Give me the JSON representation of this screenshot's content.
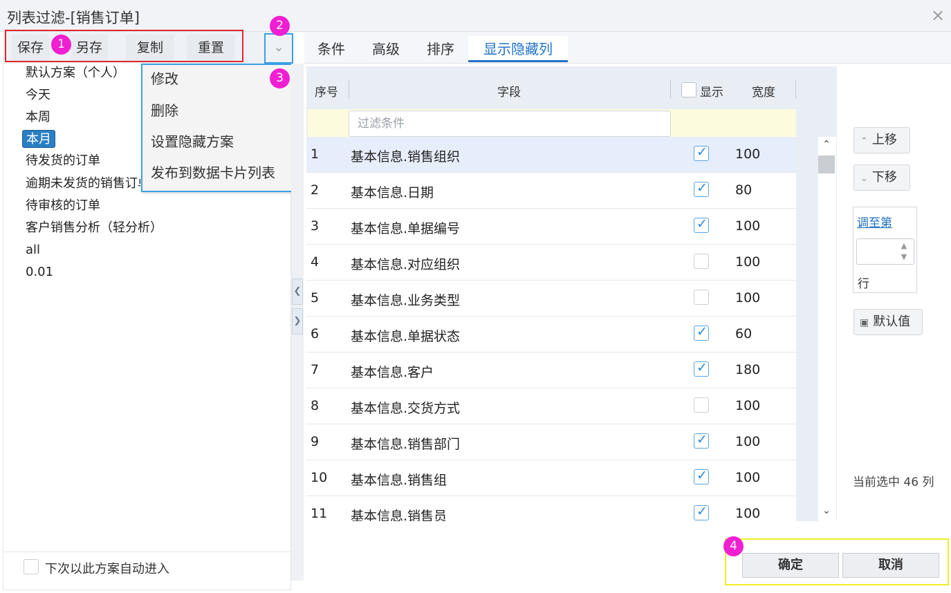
{
  "window": {
    "title": "列表过滤-[销售订单]",
    "close_glyph": "×"
  },
  "toolbar": {
    "save_label": "保存",
    "save_as_label": "另存",
    "copy_label": "复制",
    "reset_label": "重置",
    "dropdown_glyph": "⌄"
  },
  "annotations": {
    "badge1": "1",
    "badge2": "2",
    "badge3": "3",
    "badge4": "4",
    "red_box_color": "#e0262e",
    "blue_box_color": "#3aa0e6",
    "yellow_box_color": "#f2ed22",
    "badge_color": "#f01fd1"
  },
  "schemes": [
    {
      "label": "默认方案（个人）"
    },
    {
      "label": "今天"
    },
    {
      "label": "本周"
    },
    {
      "label": "本月",
      "selected": true
    },
    {
      "label": "待发货的订单"
    },
    {
      "label": "逾期未发货的销售订单"
    },
    {
      "label": "待审核的订单"
    },
    {
      "label": "客户销售分析（轻分析）"
    },
    {
      "label": "all"
    },
    {
      "label": "0.01"
    }
  ],
  "scheme_menu": [
    {
      "label": "修改"
    },
    {
      "label": "删除"
    },
    {
      "label": "设置隐藏方案"
    },
    {
      "label": "发布到数据卡片列表"
    }
  ],
  "auto_enter": {
    "label": "下次以此方案自动进入",
    "checked": false
  },
  "tabs": [
    {
      "label": "条件"
    },
    {
      "label": "高级"
    },
    {
      "label": "排序"
    },
    {
      "label": "显示隐藏列",
      "active": true
    }
  ],
  "grid": {
    "headers": {
      "no": "序号",
      "field": "字段",
      "show": "显示",
      "width": "宽度"
    },
    "filter_placeholder": "过滤条件",
    "rows": [
      {
        "no": "1",
        "field": "基本信息.销售组织",
        "show": true,
        "width": "100",
        "selected": true
      },
      {
        "no": "2",
        "field": "基本信息.日期",
        "show": true,
        "width": "80"
      },
      {
        "no": "3",
        "field": "基本信息.单据编号",
        "show": true,
        "width": "100"
      },
      {
        "no": "4",
        "field": "基本信息.对应组织",
        "show": false,
        "width": "100"
      },
      {
        "no": "5",
        "field": "基本信息.业务类型",
        "show": false,
        "width": "100"
      },
      {
        "no": "6",
        "field": "基本信息.单据状态",
        "show": true,
        "width": "60"
      },
      {
        "no": "7",
        "field": "基本信息.客户",
        "show": true,
        "width": "180"
      },
      {
        "no": "8",
        "field": "基本信息.交货方式",
        "show": false,
        "width": "100"
      },
      {
        "no": "9",
        "field": "基本信息.销售部门",
        "show": true,
        "width": "100"
      },
      {
        "no": "10",
        "field": "基本信息.销售组",
        "show": true,
        "width": "100"
      },
      {
        "no": "11",
        "field": "基本信息.销售员",
        "show": true,
        "width": "100"
      }
    ]
  },
  "side": {
    "move_up_label": "上移",
    "move_down_label": "下移",
    "jump_to_label": "调至第",
    "jump_value": "",
    "row_label": "行",
    "default_label": "默认值",
    "selected_count_text": "当前选中 46 列"
  },
  "footer": {
    "ok_label": "确定",
    "cancel_label": "取消"
  }
}
